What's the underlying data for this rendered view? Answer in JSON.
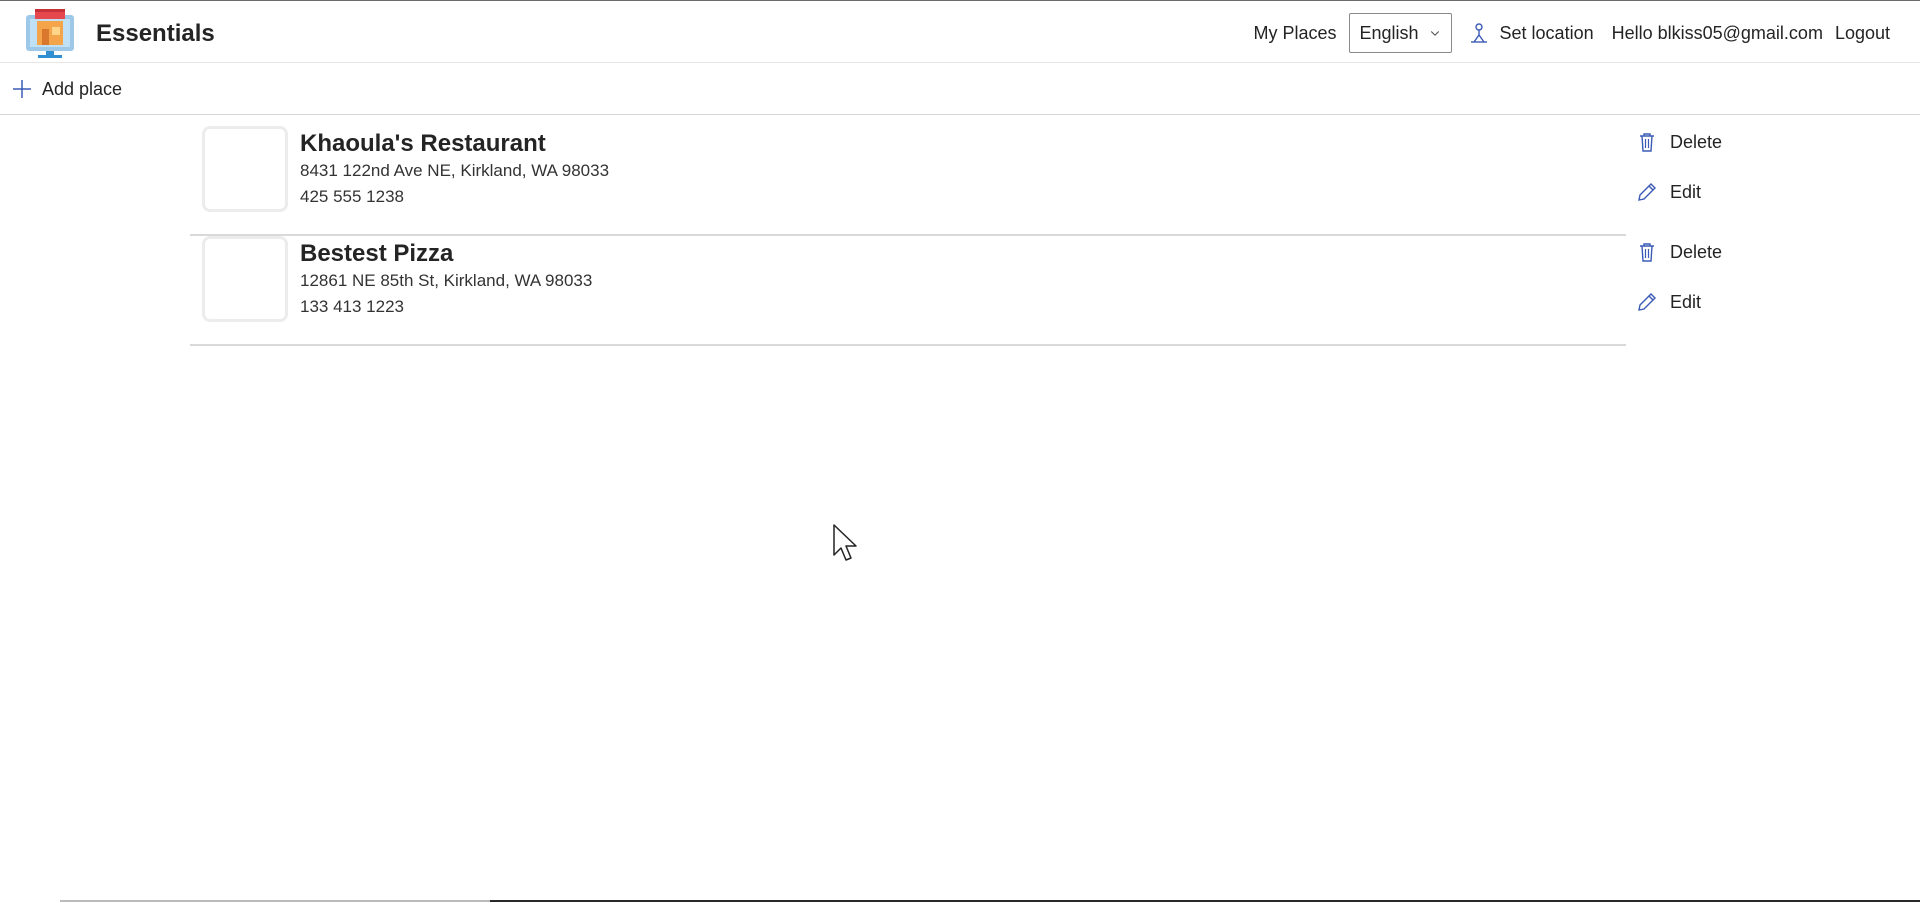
{
  "header": {
    "app_title": "Essentials",
    "logo_icon": "storefront-logo-icon",
    "nav": {
      "my_places": "My Places",
      "language": "English",
      "set_location": "Set location",
      "greeting": "Hello blkiss05@gmail.com",
      "logout": "Logout"
    }
  },
  "commandbar": {
    "add_place": "Add place"
  },
  "places": [
    {
      "name": "Khaoula's Restaurant",
      "address": "8431 122nd Ave NE, Kirkland, WA 98033",
      "phone": "425 555 1238",
      "delete_label": "Delete",
      "edit_label": "Edit"
    },
    {
      "name": "Bestest Pizza",
      "address": "12861 NE 85th St, Kirkland, WA 98033",
      "phone": "133 413 1223",
      "delete_label": "Delete",
      "edit_label": "Edit"
    }
  ],
  "colors": {
    "accent": "#3b5bb5",
    "text": "#242424",
    "divider": "#d9d9d9"
  }
}
